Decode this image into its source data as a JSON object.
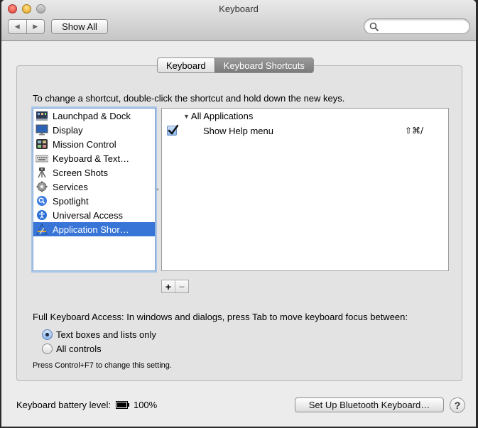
{
  "window": {
    "title": "Keyboard"
  },
  "toolbar": {
    "back_icon": "◀",
    "forward_icon": "▶",
    "show_all_label": "Show All",
    "search_placeholder": ""
  },
  "tabs": [
    {
      "label": "Keyboard",
      "selected": false
    },
    {
      "label": "Keyboard Shortcuts",
      "selected": true
    }
  ],
  "instructions": "To change a shortcut, double-click the shortcut and hold down the new keys.",
  "categories": [
    {
      "label": "Launchpad & Dock",
      "icon": "launchpad-dock-icon"
    },
    {
      "label": "Display",
      "icon": "display-icon"
    },
    {
      "label": "Mission Control",
      "icon": "mission-control-icon"
    },
    {
      "label": "Keyboard & Text…",
      "icon": "keyboard-icon"
    },
    {
      "label": "Screen Shots",
      "icon": "screenshots-icon"
    },
    {
      "label": "Services",
      "icon": "gear-icon"
    },
    {
      "label": "Spotlight",
      "icon": "spotlight-icon"
    },
    {
      "label": "Universal Access",
      "icon": "universal-access-icon"
    },
    {
      "label": "Application Shor…",
      "icon": "app-shortcuts-icon",
      "selected": true
    }
  ],
  "shortcuts": {
    "group_label": "All Applications",
    "items": [
      {
        "enabled": true,
        "name": "Show Help menu",
        "keys": "⇧⌘/"
      }
    ]
  },
  "list_controls": {
    "add": "+",
    "remove": "−"
  },
  "full_keyboard_access": {
    "label": "Full Keyboard Access: In windows and dialogs, press Tab to move keyboard focus between:",
    "options": [
      {
        "label": "Text boxes and lists only",
        "selected": true
      },
      {
        "label": "All controls",
        "selected": false
      }
    ],
    "hint": "Press Control+F7 to change this setting."
  },
  "battery": {
    "label": "Keyboard battery level:",
    "value": "100%"
  },
  "bluetooth_button": "Set Up Bluetooth Keyboard…",
  "help_label": "?"
}
